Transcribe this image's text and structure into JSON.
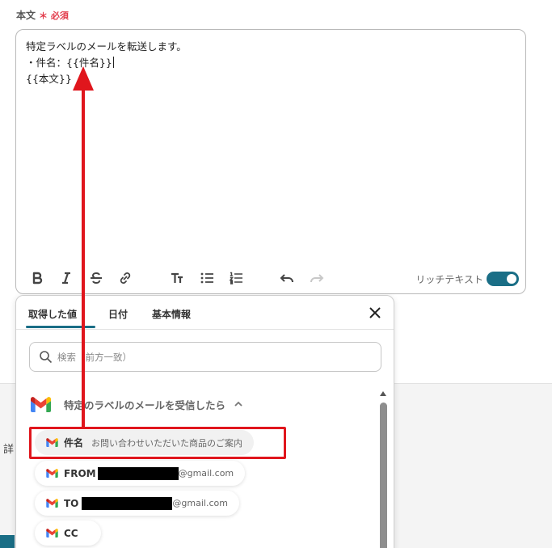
{
  "field": {
    "label": "本文",
    "required_mark": "＊",
    "required_text": "必須"
  },
  "editor": {
    "lines": [
      "特定ラベルのメールを転送します。",
      "・件名：{{件名}}",
      "{{本文}}"
    ],
    "rich_text_label": "リッチテキスト",
    "rich_text_enabled": true,
    "toolbar": [
      "bold-icon",
      "italic-icon",
      "strikethrough-icon",
      "link-icon",
      "text-format-icon",
      "bullet-list-icon",
      "numbered-list-icon",
      "undo-icon",
      "redo-icon"
    ]
  },
  "side_label": "詳",
  "panel": {
    "tabs": [
      {
        "label": "取得した値",
        "active": true
      },
      {
        "label": "日付",
        "active": false
      },
      {
        "label": "基本情報",
        "active": false
      }
    ],
    "search": {
      "placeholder": "検索（前方一致）"
    },
    "section": {
      "title": "特定のラベルのメールを受信したら",
      "icon": "gmail-icon",
      "expanded": true
    },
    "items": [
      {
        "name": "件名",
        "value": "お問い合わせいただいた商品のご案内",
        "redacted": false
      },
      {
        "name": "FROM",
        "value": "@gmail.com",
        "redacted": true
      },
      {
        "name": "TO",
        "value": "@gmail.com",
        "redacted": true
      },
      {
        "name": "CC",
        "value": "",
        "redacted": false
      }
    ]
  },
  "colors": {
    "accent": "#1a6e86",
    "required": "#e23b4b",
    "annotation_red": "#e0161d"
  }
}
